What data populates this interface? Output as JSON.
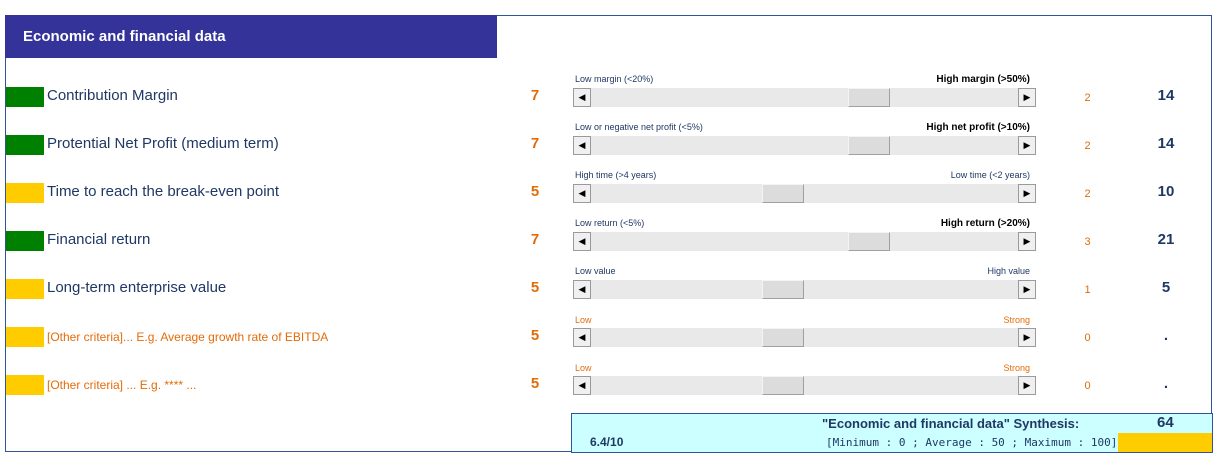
{
  "header": {
    "title": "Economic and financial data"
  },
  "colors": {
    "green": "#008000",
    "yellow": "#ffcc00",
    "orange": "#e36c09",
    "navy": "#1f3864",
    "header_bg": "#333399",
    "synthesis_bg": "#ccffff"
  },
  "criteria": [
    {
      "label": "Contribution Margin",
      "status_color": "green",
      "score": "7",
      "low_label": "Low margin (<20%)",
      "high_label": "High margin (>50%)",
      "slider_value": 7,
      "slider_max": 10,
      "weight": "2",
      "total": "14"
    },
    {
      "label": "Protential Net Profit (medium term)",
      "status_color": "green",
      "score": "7",
      "low_label": "Low or negative net profit (<5%)",
      "high_label": "High net profit (>10%)",
      "slider_value": 7,
      "slider_max": 10,
      "weight": "2",
      "total": "14"
    },
    {
      "label": "Time to reach the break-even point",
      "status_color": "yellow",
      "score": "5",
      "low_label": "High time (>4 years)",
      "high_label": "Low time (<2 years)",
      "slider_value": 5,
      "slider_max": 10,
      "weight": "2",
      "total": "10"
    },
    {
      "label": "Financial return",
      "status_color": "green",
      "score": "7",
      "low_label": "Low return (<5%)",
      "high_label": "High return (>20%)",
      "slider_value": 7,
      "slider_max": 10,
      "weight": "3",
      "total": "21"
    },
    {
      "label": "Long-term enterprise value",
      "status_color": "yellow",
      "score": "5",
      "low_label": "Low value",
      "high_label": "High value",
      "slider_value": 5,
      "slider_max": 10,
      "weight": "1",
      "total": "5"
    },
    {
      "label": "[Other criteria]... E.g. Average growth rate of EBITDA",
      "status_color": "yellow",
      "score": "5",
      "low_label": "Low",
      "high_label": "Strong",
      "slider_value": 5,
      "slider_max": 10,
      "weight": "0",
      "total": "."
    },
    {
      "label": "[Other criteria] ... E.g. **** ...",
      "status_color": "yellow",
      "score": "5",
      "low_label": "Low",
      "high_label": "Strong",
      "slider_value": 5,
      "slider_max": 10,
      "weight": "0",
      "total": "."
    }
  ],
  "synthesis": {
    "title": "\"Economic and financial data\" Synthesis:",
    "total": "64",
    "range": "[Minimum : 0 ; Average : 50 ; Maximum : 100]",
    "rating": "6.4/10"
  }
}
